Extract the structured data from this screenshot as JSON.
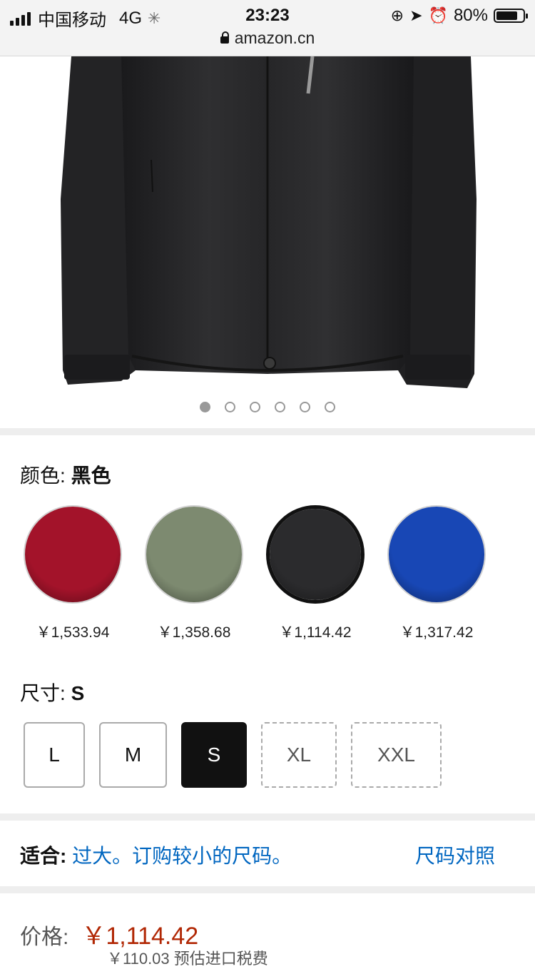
{
  "status_bar": {
    "carrier": "中国移动",
    "network": "4G",
    "time": "23:23",
    "battery": "80%",
    "battery_level": 0.8,
    "url": "amazon.cn"
  },
  "gallery": {
    "image_count": 6,
    "active_index": 0
  },
  "color": {
    "label": "颜色:",
    "selected": "黑色",
    "options": [
      {
        "name": "red-jacket",
        "price": "￥1,533.94",
        "color": "#a3132a"
      },
      {
        "name": "green-jacket",
        "price": "￥1,358.68",
        "color": "#7d8a70"
      },
      {
        "name": "black-jacket",
        "price": "￥1,114.42",
        "color": "#2b2b2d"
      },
      {
        "name": "blue-jacket",
        "price": "￥1,317.42",
        "color": "#1847b5"
      }
    ]
  },
  "size": {
    "label": "尺寸:",
    "selected": "S",
    "options": [
      {
        "label": "L",
        "state": "available"
      },
      {
        "label": "M",
        "state": "available"
      },
      {
        "label": "S",
        "state": "selected"
      },
      {
        "label": "XL",
        "state": "unavailable"
      },
      {
        "label": "XXL",
        "state": "unavailable"
      }
    ]
  },
  "fit": {
    "label": "适合:",
    "message": "过大。订购较小的尺码。",
    "size_chart_link": "尺码对照"
  },
  "price": {
    "label": "价格:",
    "value": "￥1,114.42",
    "tax_note": "￥110.03 预估进口税费"
  },
  "colors": {
    "link": "#0066c0",
    "price": "#b12704"
  }
}
